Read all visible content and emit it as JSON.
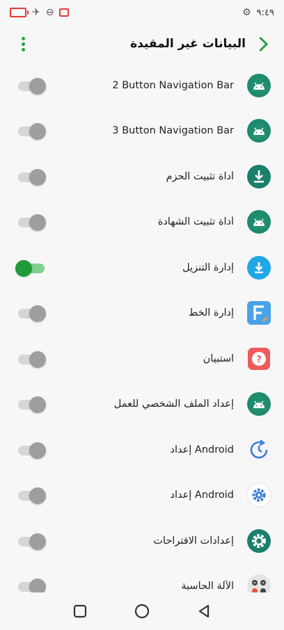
{
  "status_bar": {
    "time": "٩:٤٩"
  },
  "header": {
    "title": "البيانات غير المقيدة"
  },
  "apps": [
    {
      "name": "2 Button Navigation Bar",
      "icon": "android-icon",
      "enabled": false
    },
    {
      "name": "3 Button Navigation Bar",
      "icon": "android-icon",
      "enabled": false
    },
    {
      "name": "أداة تثبيت الحزم",
      "icon": "download-icon",
      "enabled": false
    },
    {
      "name": "أداة تثبيت الشهادة",
      "icon": "android-icon",
      "enabled": false
    },
    {
      "name": "إدارة التنزيل",
      "icon": "download-blue-icon",
      "enabled": true
    },
    {
      "name": "إدارة الخط",
      "icon": "font-manager-icon",
      "enabled": false
    },
    {
      "name": "استبيان",
      "icon": "survey-icon",
      "enabled": false
    },
    {
      "name": "إعداد الملف الشخصي للعمل",
      "icon": "android-icon",
      "enabled": false
    },
    {
      "name": "إعداد Android",
      "icon": "setup-clock-icon",
      "enabled": false
    },
    {
      "name": "إعداد Android",
      "icon": "setup-gear-icon",
      "enabled": false
    },
    {
      "name": "إعدادات الاقتراحات",
      "icon": "suggestions-settings-icon",
      "enabled": false
    },
    {
      "name": "الآلة الحاسبة",
      "icon": "calculator-icon",
      "enabled": false
    }
  ],
  "colors": {
    "accent": "#2e9b47",
    "toggle_on": "#1f9b3a",
    "toggle_off": "#9e9e9e"
  }
}
